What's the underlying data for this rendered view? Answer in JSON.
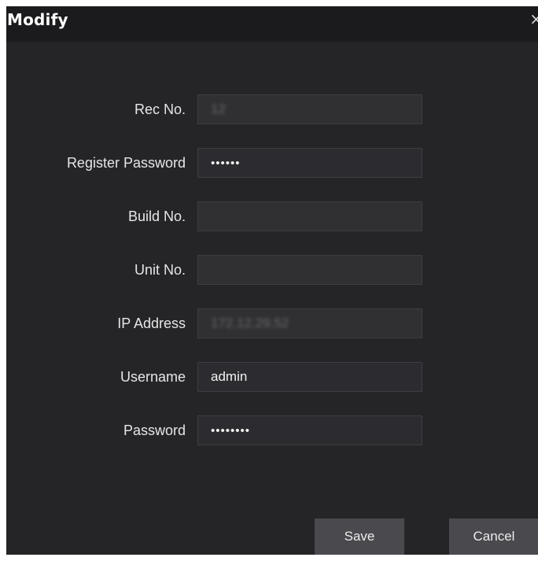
{
  "dialog": {
    "title": "Modify",
    "close_glyph": "×"
  },
  "fields": {
    "rec_no": {
      "label": "Rec No.",
      "value": "12"
    },
    "register_password": {
      "label": "Register Password",
      "value": "••••••"
    },
    "build_no": {
      "label": "Build No.",
      "value": ""
    },
    "unit_no": {
      "label": "Unit No.",
      "value": ""
    },
    "ip_address": {
      "label": "IP Address",
      "value": "172.12.29.52"
    },
    "username": {
      "label": "Username",
      "value": "admin"
    },
    "password": {
      "label": "Password",
      "value": "••••••••"
    }
  },
  "buttons": {
    "save": "Save",
    "cancel": "Cancel"
  }
}
